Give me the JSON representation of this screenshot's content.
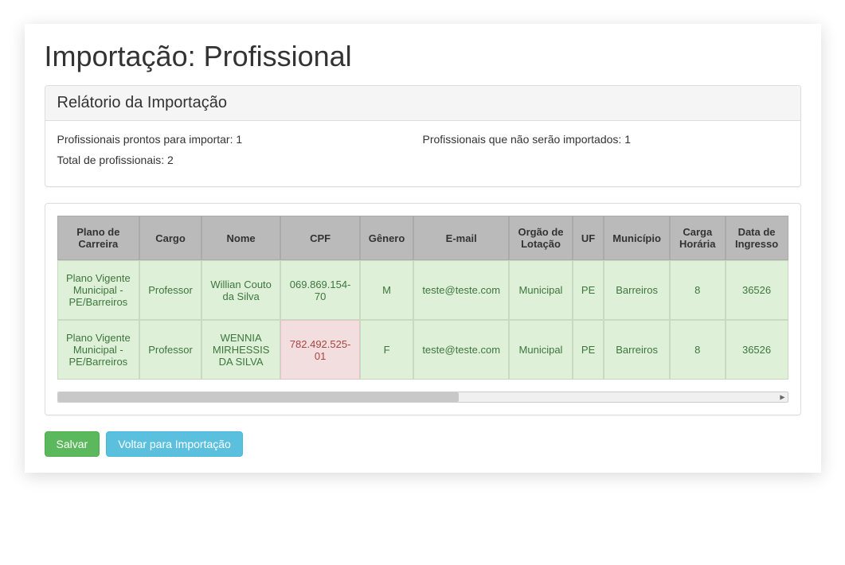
{
  "page": {
    "title": "Importação: Profissional"
  },
  "report": {
    "heading": "Relátorio da Importação",
    "ready_label": "Profissionais prontos para importar: 1",
    "not_imported_label": "Profissionais que não serão importados: 1",
    "total_label": "Total de profissionais: 2"
  },
  "table": {
    "headers": {
      "plano": "Plano de Carreira",
      "cargo": "Cargo",
      "nome": "Nome",
      "cpf": "CPF",
      "genero": "Gênero",
      "email": "E-mail",
      "orgao": "Orgão de Lotação",
      "uf": "UF",
      "municipio": "Município",
      "carga": "Carga Horária",
      "data": "Data de Ingresso"
    },
    "rows": [
      {
        "plano": "Plano Vigente Municipal - PE/Barreiros",
        "cargo": "Professor",
        "nome": "Willian Couto da Silva",
        "cpf": "069.869.154-70",
        "cpf_error": false,
        "genero": "M",
        "email": "teste@teste.com",
        "orgao": "Municipal",
        "uf": "PE",
        "municipio": "Barreiros",
        "carga": "8",
        "data": "36526"
      },
      {
        "plano": "Plano Vigente Municipal - PE/Barreiros",
        "cargo": "Professor",
        "nome": "WENNIA MIRHESSIS DA SILVA",
        "cpf": "782.492.525-01",
        "cpf_error": true,
        "genero": "F",
        "email": "teste@teste.com",
        "orgao": "Municipal",
        "uf": "PE",
        "municipio": "Barreiros",
        "carga": "8",
        "data": "36526"
      }
    ]
  },
  "buttons": {
    "save": "Salvar",
    "back": "Voltar para Importação"
  }
}
